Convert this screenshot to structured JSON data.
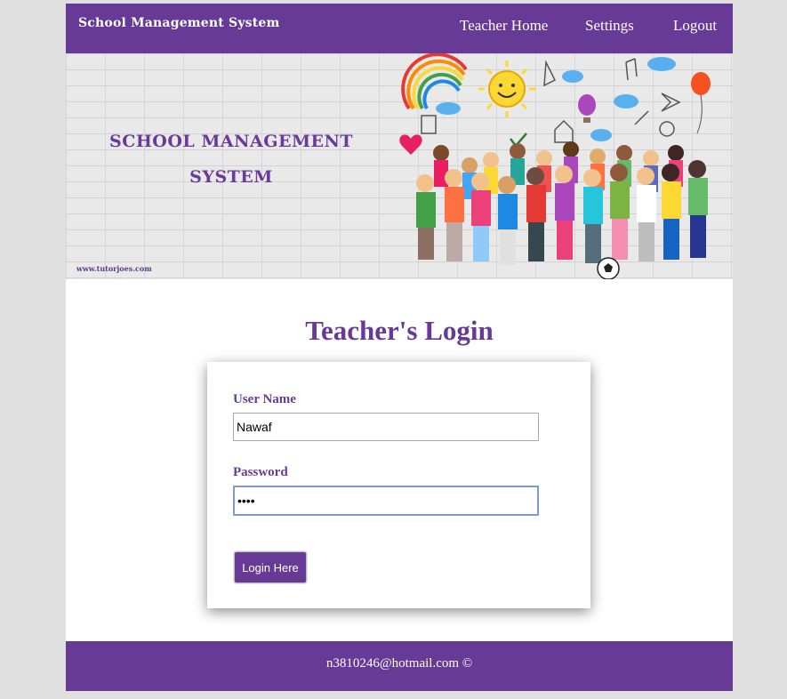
{
  "navbar": {
    "brand": "School Management System",
    "links": [
      "Teacher Home",
      "Settings",
      "Logout"
    ]
  },
  "banner": {
    "title_line1": "SCHOOL MANAGEMENT",
    "title_line2": "SYSTEM",
    "website": "www.tutorjoes.com"
  },
  "login": {
    "heading": "Teacher's Login",
    "username_label": "User Name",
    "username_value": "Nawaf",
    "password_label": "Password",
    "password_value": "abcd",
    "button_label": "Login Here"
  },
  "footer": {
    "text": "n3810246@hotmail.com ©"
  },
  "colors": {
    "primary": "#673a96",
    "background": "#e0e0e0"
  }
}
